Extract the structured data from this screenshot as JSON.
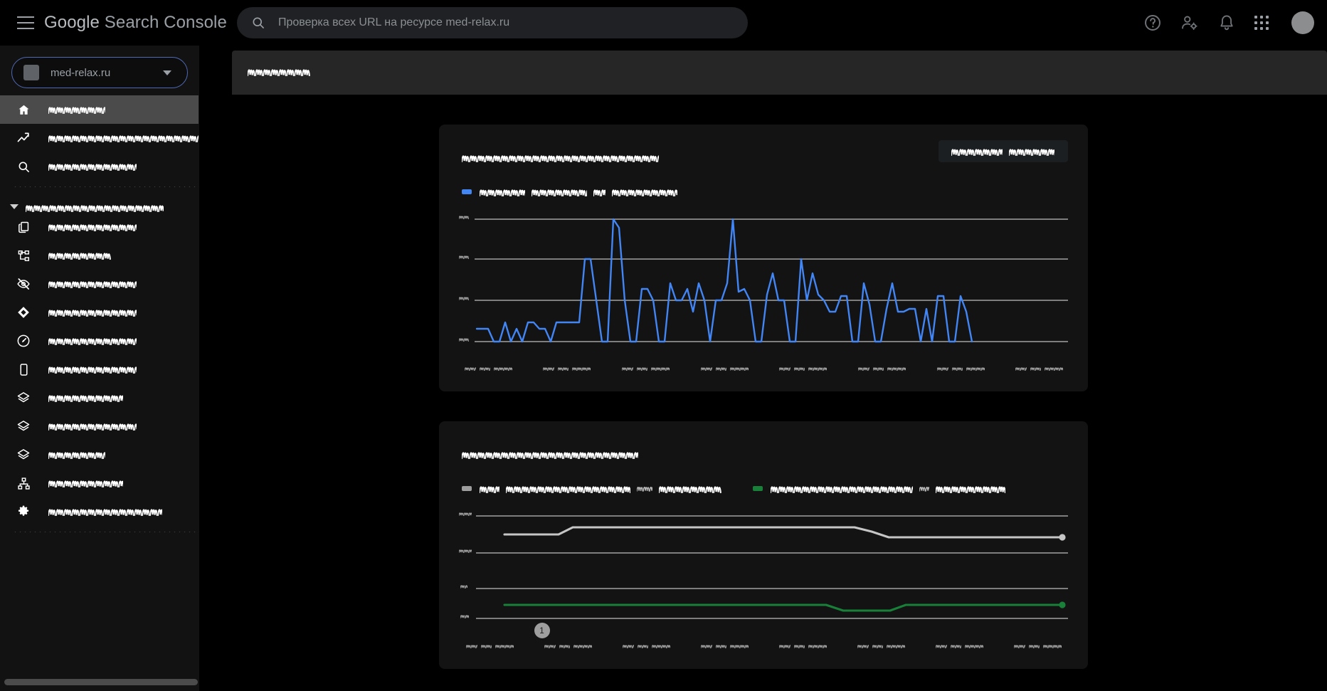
{
  "app": {
    "brand_google": "Google",
    "brand_product": " Search Console",
    "background": "#000000",
    "sidebar_bg": "#121212",
    "card_bg": "#131313"
  },
  "header": {
    "menu_icon": "hamburger-icon",
    "search": {
      "icon": "search-icon",
      "value": "",
      "placeholder": "Проверка всех URL на ресурсе med-relax.ru"
    },
    "actions": [
      {
        "name": "help-icon",
        "label": ""
      },
      {
        "name": "account-settings-icon",
        "label": ""
      },
      {
        "name": "notifications-bell-icon",
        "label": ""
      },
      {
        "name": "apps-grid-icon",
        "label": ""
      },
      {
        "name": "avatar",
        "label": ""
      }
    ]
  },
  "sidebar": {
    "property_selector": {
      "favicon": "site-favicon",
      "value": "med-relax.ru",
      "caret": "chevron-down-icon"
    },
    "items": [
      {
        "icon": "home-icon",
        "label_redacted": true,
        "label_len": 9,
        "selected": true
      },
      {
        "icon": "trending-up-icon",
        "label_redacted": true,
        "label_len": 26,
        "selected": false
      },
      {
        "icon": "search-icon",
        "label_redacted": true,
        "label_len": 14,
        "selected": false
      }
    ],
    "group": {
      "caret": "caret-down-icon",
      "label_redacted": true,
      "label_len": 22
    },
    "group_items": [
      {
        "icon": "pages-copy-icon",
        "label_redacted": true,
        "label_len": 14
      },
      {
        "icon": "sitemap-icon",
        "label_redacted": true,
        "label_len": 10
      },
      {
        "icon": "eye-off-icon",
        "label_redacted": true,
        "label_len": 14
      },
      {
        "icon": "diamond-icon",
        "label_redacted": true,
        "label_len": 14
      },
      {
        "icon": "speedometer-icon",
        "label_redacted": true,
        "label_len": 14
      },
      {
        "icon": "mobile-icon",
        "label_redacted": true,
        "label_len": 14
      },
      {
        "icon": "layers-icon",
        "label_redacted": true,
        "label_len": 12
      },
      {
        "icon": "layers-icon",
        "label_redacted": true,
        "label_len": 14
      },
      {
        "icon": "layers-icon",
        "label_redacted": true,
        "label_len": 9
      },
      {
        "icon": "links-sitemap-icon",
        "label_redacted": true,
        "label_len": 12
      },
      {
        "icon": "gear-icon",
        "label_redacted": true,
        "label_len": 18
      }
    ],
    "scrollbar": "horizontal-scrollbar"
  },
  "page": {
    "title_redacted": true,
    "title_len": 10
  },
  "cards": [
    {
      "name": "performance-card",
      "title_redacted": true,
      "title_len": 28,
      "action_button": {
        "redacted": true,
        "words": [
          10,
          9
        ]
      },
      "legend": [
        {
          "color": "#4285f4",
          "redacted": true,
          "words": [
            9,
            11,
            2,
            12
          ]
        }
      ]
    },
    {
      "name": "indexing-card",
      "title_redacted": true,
      "title_len": 25,
      "legend": [
        {
          "color": "#9e9e9e",
          "redacted": true,
          "words": [
            4,
            24,
            3,
            12
          ]
        },
        {
          "color": "#188038",
          "redacted": true,
          "words": [
            27,
            2,
            13
          ]
        }
      ]
    }
  ],
  "chart_data": [
    {
      "name": "performance-chart",
      "type": "line",
      "title": "",
      "xlabel": "",
      "ylabel": "",
      "grid": true,
      "gridlines": 4,
      "axis_labels_redacted": true,
      "ytick_count": 4,
      "xtick_count": 8,
      "xtick_pattern": "date",
      "series": [
        {
          "name": "clicks",
          "color": "#4285f4",
          "values": [
            22,
            22,
            22,
            8,
            8,
            33,
            8,
            22,
            8,
            33,
            33,
            22,
            22,
            8,
            22,
            22,
            22,
            22,
            22,
            55,
            55,
            22,
            8,
            8,
            78,
            72,
            22,
            8,
            8,
            42,
            42,
            22,
            8,
            8,
            45,
            22,
            22,
            33,
            16,
            45,
            22,
            8,
            22,
            22,
            45,
            78,
            40,
            33,
            22,
            8,
            8,
            36,
            60,
            22,
            22,
            8,
            8,
            55,
            22,
            60,
            36,
            22,
            16,
            16,
            34,
            34,
            8,
            8,
            45,
            26,
            8,
            8,
            30,
            45,
            16,
            16,
            30,
            30,
            8,
            30,
            8,
            34,
            34,
            8,
            8,
            34,
            16,
            8
          ]
        }
      ],
      "ylim": [
        0,
        90
      ]
    },
    {
      "name": "indexing-chart",
      "type": "line",
      "title": "",
      "xlabel": "",
      "ylabel": "",
      "grid": true,
      "gridlines": 4,
      "axis_labels_redacted": true,
      "ytick_count": 4,
      "xtick_count": 8,
      "xtick_pattern": "date",
      "annotation": {
        "label": "1",
        "x_percent": 13,
        "color": "#9e9e9e"
      },
      "series": [
        {
          "name": "not-indexed",
          "color": "#c6c6c6",
          "points": [
            [
              5,
              80
            ],
            [
              18,
              80
            ],
            [
              22,
              86
            ],
            [
              52,
              86
            ],
            [
              56,
              83
            ],
            [
              60,
              78
            ],
            [
              99,
              78
            ]
          ]
        },
        {
          "name": "indexed",
          "color": "#188038",
          "points": [
            [
              5,
              14
            ],
            [
              44,
              14
            ],
            [
              48,
              9
            ],
            [
              58,
              9
            ],
            [
              62,
              14
            ],
            [
              99,
              14
            ]
          ]
        }
      ],
      "ylim": [
        0,
        100
      ]
    }
  ]
}
